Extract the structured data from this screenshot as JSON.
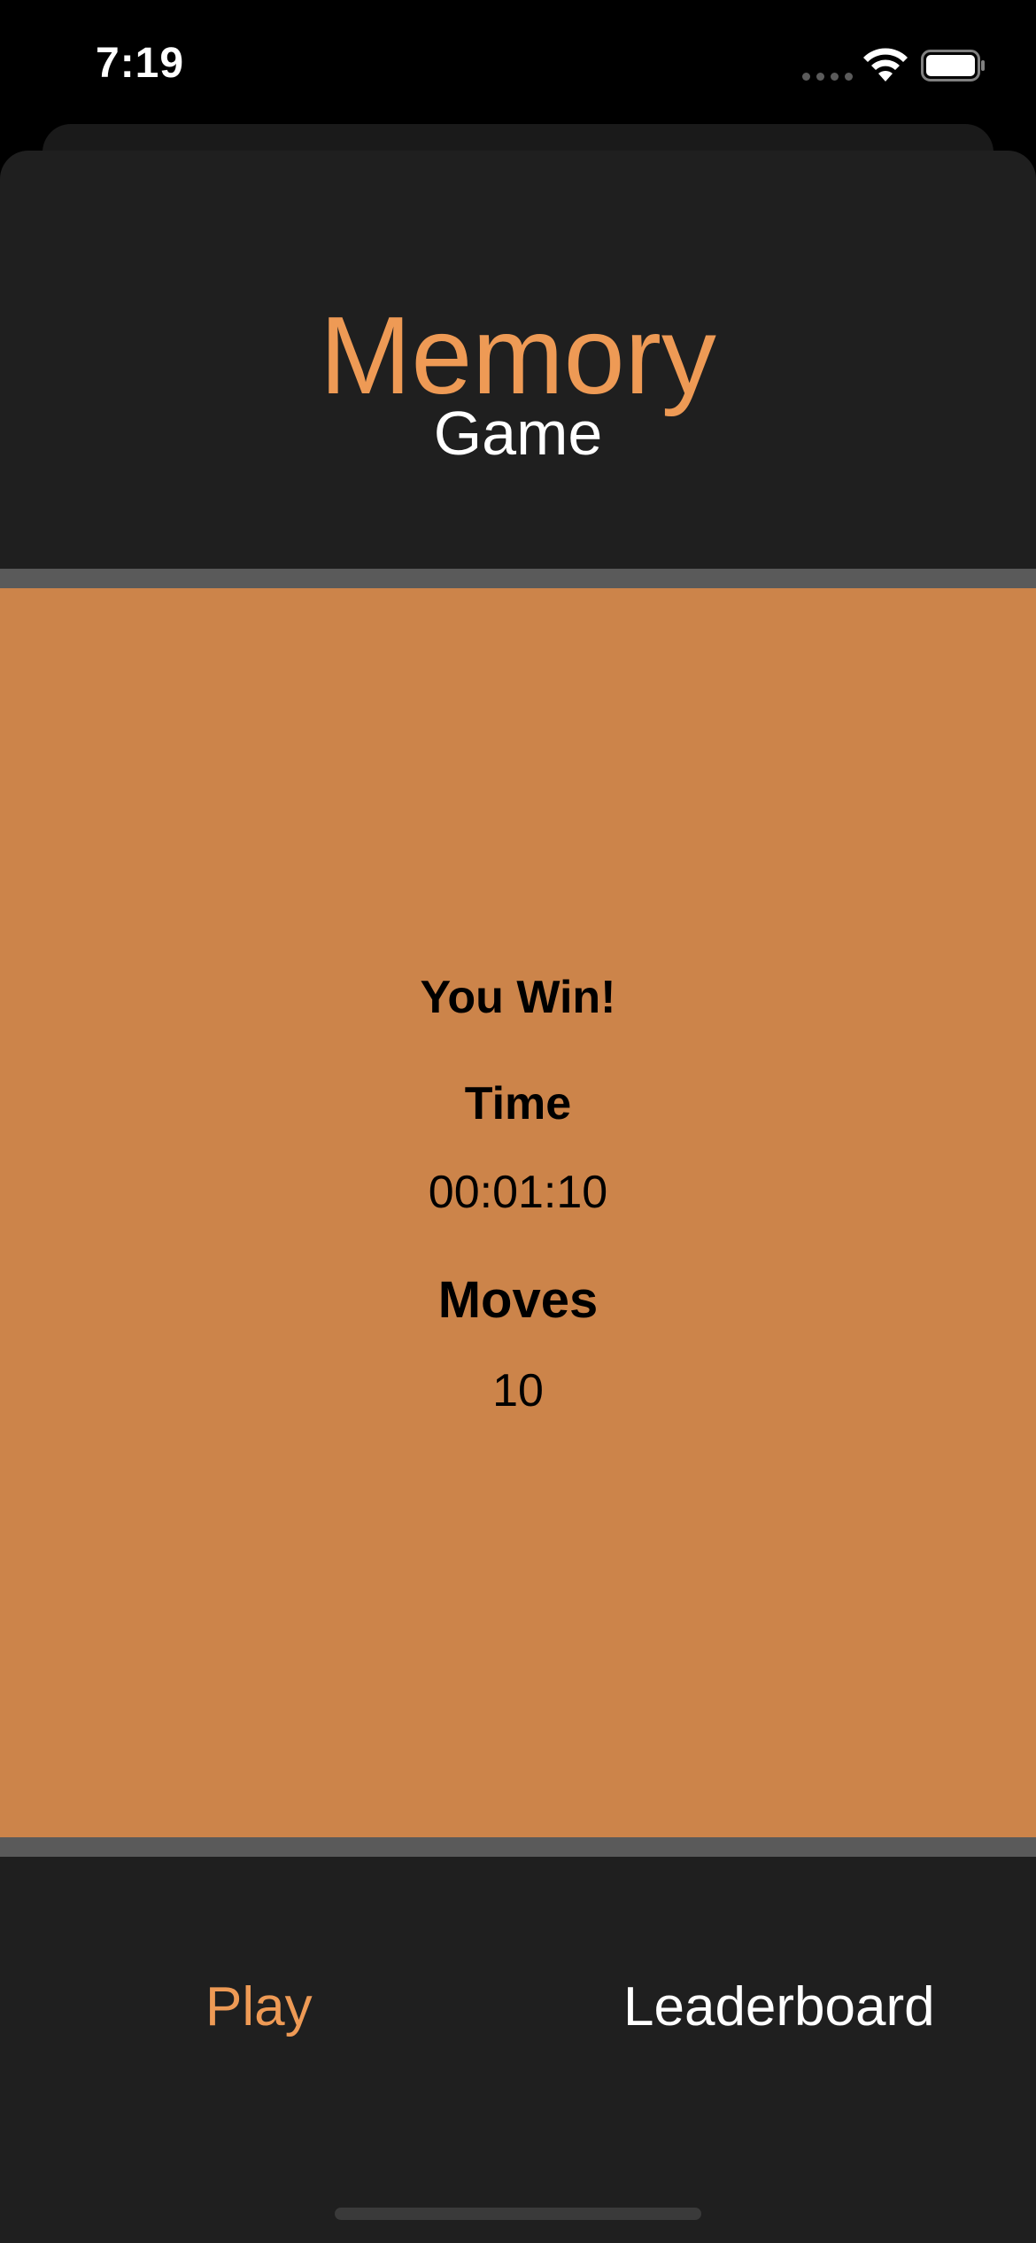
{
  "status_bar": {
    "time": "7:19",
    "icons": [
      "signal-icon",
      "wifi-icon",
      "battery-icon"
    ]
  },
  "header": {
    "title": "Memory",
    "subtitle": "Game"
  },
  "result": {
    "heading": "You Win!",
    "time_label": "Time",
    "time_value": "00:01:10",
    "moves_label": "Moves",
    "moves_value": "10"
  },
  "tabs": [
    {
      "label": "Play",
      "selected": true
    },
    {
      "label": "Leaderboard",
      "selected": false
    }
  ],
  "colors": {
    "accent": "#ee9a55",
    "game_area": "#cc844a",
    "sheet": "#1f1f1f",
    "divider": "#5a5a5a"
  }
}
